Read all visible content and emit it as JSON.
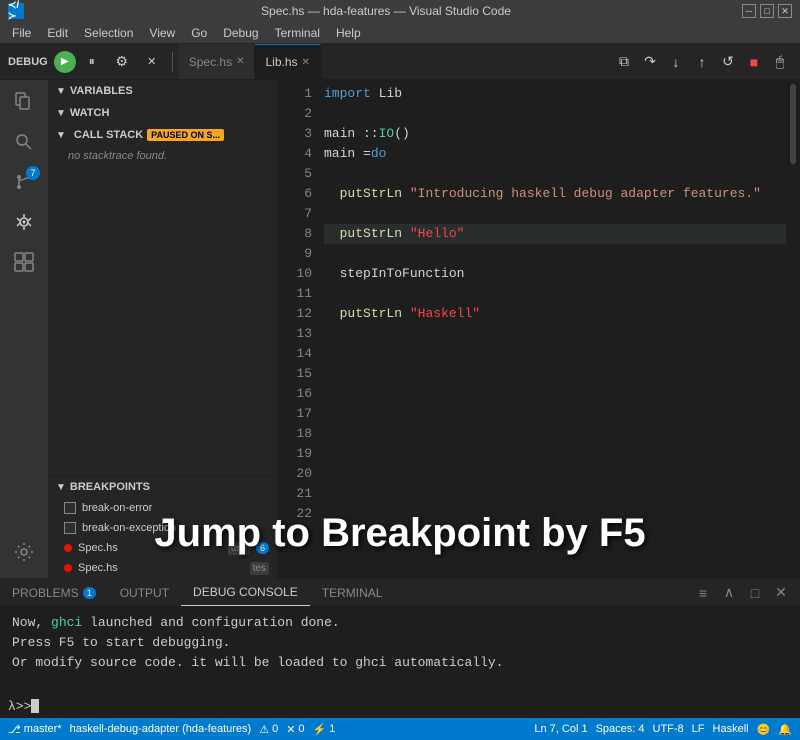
{
  "titleBar": {
    "title": "Spec.hs — hda-features — Visual Studio Code",
    "controls": [
      "─",
      "□",
      "✕"
    ]
  },
  "menuBar": {
    "items": [
      "File",
      "Edit",
      "Selection",
      "View",
      "Go",
      "Debug",
      "Terminal",
      "Help"
    ]
  },
  "toolbar": {
    "debugLabel": "DEBUG",
    "tabs": [
      {
        "name": "Spec.hs",
        "active": false
      },
      {
        "name": "Lib.hs",
        "active": true
      }
    ]
  },
  "activityBar": {
    "icons": [
      {
        "name": "explorer-icon",
        "symbol": "⎘",
        "active": false
      },
      {
        "name": "search-icon",
        "symbol": "🔍",
        "active": false
      },
      {
        "name": "source-control-icon",
        "symbol": "⑂",
        "active": false,
        "badge": "7"
      },
      {
        "name": "debug-icon",
        "symbol": "⬡",
        "active": true
      },
      {
        "name": "extensions-icon",
        "symbol": "⊞",
        "active": false
      }
    ]
  },
  "sidebar": {
    "sections": {
      "variables": {
        "label": "VARIABLES",
        "expanded": true
      },
      "watch": {
        "label": "WATCH",
        "expanded": true
      },
      "callStack": {
        "label": "CALL STACK",
        "pausedLabel": "PAUSED ON S...",
        "noStacktrace": "no stacktrace found."
      },
      "breakpoints": {
        "label": "BREAKPOINTS",
        "items": [
          {
            "name": "break-on-error",
            "checked": false,
            "dot": false,
            "label": "break-on-error",
            "tag": null,
            "count": null
          },
          {
            "name": "break-on-exception",
            "checked": false,
            "dot": false,
            "label": "break-on-exception",
            "tag": null,
            "count": null
          },
          {
            "name": "Spec.hs-1",
            "checked": true,
            "dot": true,
            "label": "Spec.hs",
            "tag": "test",
            "count": "6"
          },
          {
            "name": "Spec.hs-2",
            "checked": true,
            "dot": true,
            "label": "Spec.hs",
            "tag": "tes",
            "count": null
          }
        ]
      }
    }
  },
  "editor": {
    "activeFile": "Lib.hs",
    "lines": [
      {
        "num": 1,
        "code": "import Lib",
        "type": "import"
      },
      {
        "num": 2,
        "code": "",
        "type": "empty"
      },
      {
        "num": 3,
        "code": "main :: IO ()",
        "type": "signature"
      },
      {
        "num": 4,
        "code": "main = do",
        "type": "code"
      },
      {
        "num": 5,
        "code": "",
        "type": "active"
      },
      {
        "num": 6,
        "code": "  putStrLn \"Introducing haskell debug adapter features.\"",
        "type": "bp",
        "bp": true
      },
      {
        "num": 7,
        "code": "",
        "type": "empty"
      },
      {
        "num": 8,
        "code": "  putStrLn \"Hello\"",
        "type": "active-bp",
        "bp": true
      },
      {
        "num": 9,
        "code": "",
        "type": "empty"
      },
      {
        "num": 10,
        "code": "  stepInToFunction",
        "type": "code"
      },
      {
        "num": 11,
        "code": "",
        "type": "empty"
      },
      {
        "num": 12,
        "code": "  putStrLn \"Haskell\"",
        "type": "bp",
        "bp": true
      },
      {
        "num": 13,
        "code": "",
        "type": "empty"
      },
      {
        "num": 14,
        "code": "",
        "type": "empty"
      },
      {
        "num": 15,
        "code": "",
        "type": "empty"
      },
      {
        "num": 16,
        "code": "",
        "type": "empty"
      },
      {
        "num": 17,
        "code": "",
        "type": "empty"
      },
      {
        "num": 18,
        "code": "",
        "type": "empty"
      },
      {
        "num": 19,
        "code": "",
        "type": "empty"
      },
      {
        "num": 20,
        "code": "",
        "type": "empty"
      },
      {
        "num": 21,
        "code": "",
        "type": "empty"
      },
      {
        "num": 22,
        "code": "",
        "type": "empty"
      }
    ]
  },
  "panel": {
    "tabs": [
      {
        "label": "PROBLEMS",
        "badge": "1",
        "active": false
      },
      {
        "label": "OUTPUT",
        "badge": null,
        "active": false
      },
      {
        "label": "DEBUG CONSOLE",
        "badge": null,
        "active": true
      },
      {
        "label": "TERMINAL",
        "badge": null,
        "active": false
      }
    ],
    "consoleLines": [
      "Now, ghci launched and configuration done.",
      "Press F5 to start debugging.",
      "Or modify source code. it will be loaded to ghci automatically."
    ],
    "prompt": "λ>> "
  },
  "overlayText": "Jump to Breakpoint by F5",
  "statusBar": {
    "left": [
      {
        "label": "⎇ master*"
      },
      {
        "label": "⚠ 0"
      },
      {
        "label": "✕ 0"
      },
      {
        "label": "⚡ 1"
      }
    ],
    "right": [
      {
        "label": "Ln 7, Col 1"
      },
      {
        "label": "Spaces: 4"
      },
      {
        "label": "UTF-8"
      },
      {
        "label": "LF"
      },
      {
        "label": "Haskell"
      },
      {
        "label": "😊"
      },
      {
        "label": "🔔"
      }
    ],
    "debugInfo": "haskell-debug-adapter (hda-features)"
  }
}
